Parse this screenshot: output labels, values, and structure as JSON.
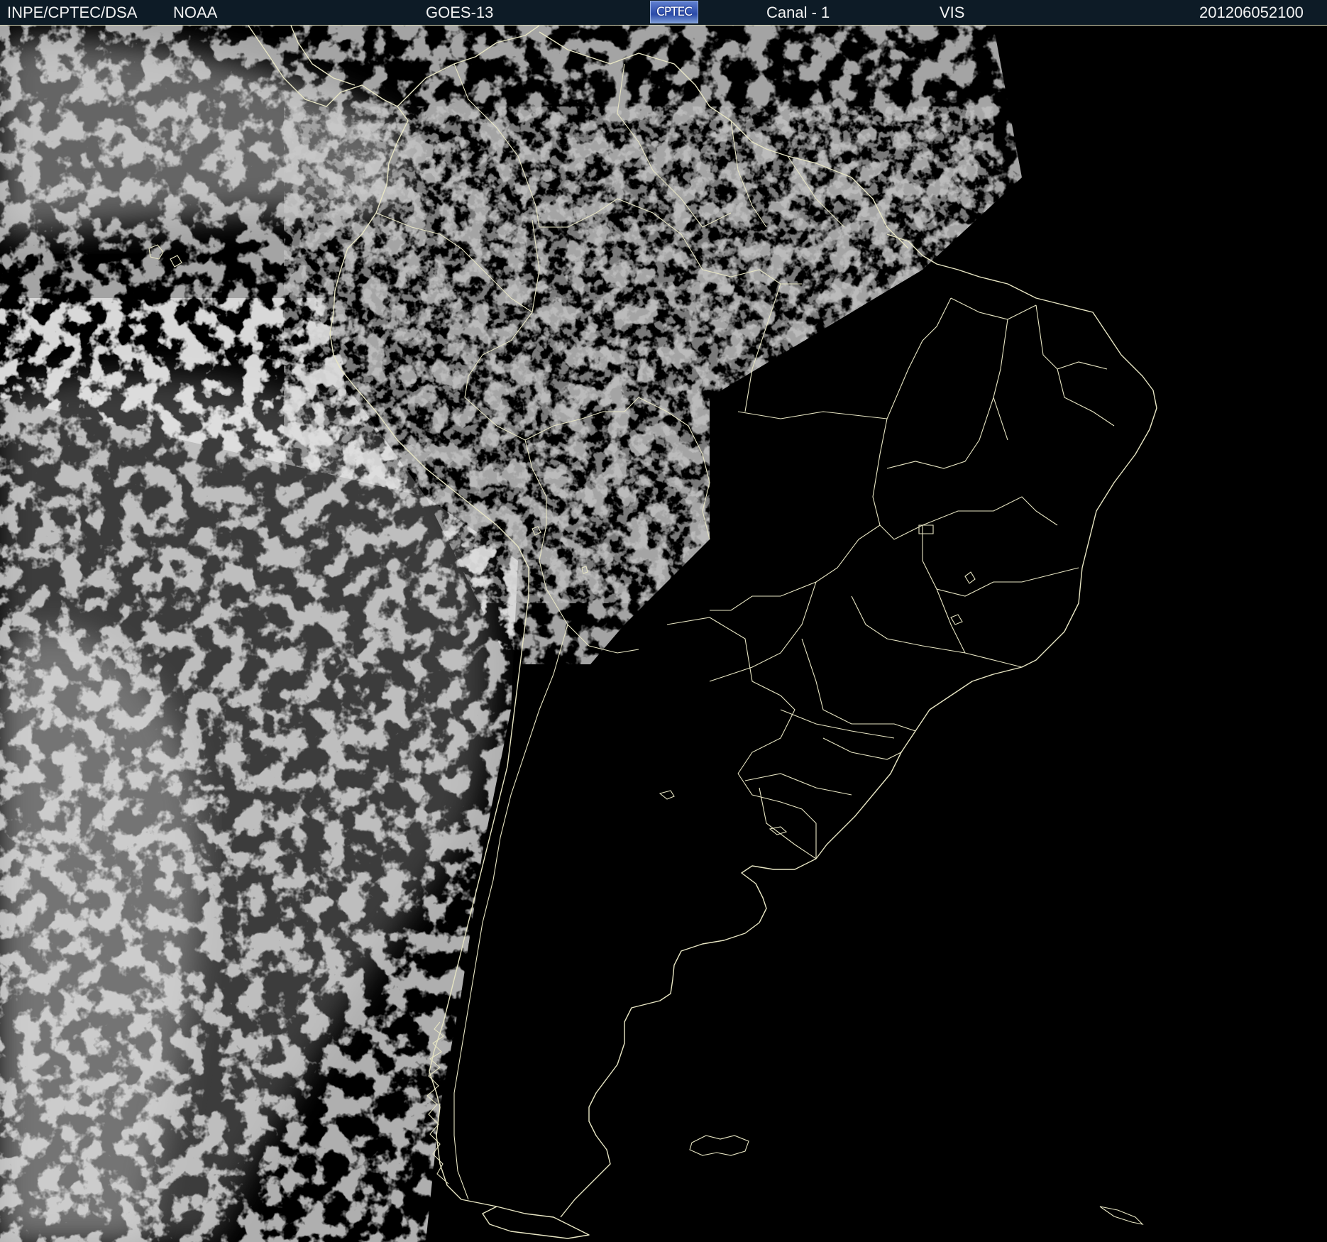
{
  "header": {
    "agency": "INPE/CPTEC/DSA",
    "source": "NOAA",
    "satellite": "GOES-13",
    "logo_text": "CPTEC",
    "channel": "Canal - 1",
    "band": "VIS",
    "timestamp": "201206052100"
  },
  "colors": {
    "header_bg": "#0d1b26",
    "header_text": "#f2f2f2",
    "border_lines": "#e8e6c4",
    "land_dark": "#000000",
    "cloud_bright": "#c8c8c8",
    "logo_blue": "#2a4aa8"
  },
  "map": {
    "type": "satellite visible image",
    "region": "South America"
  }
}
